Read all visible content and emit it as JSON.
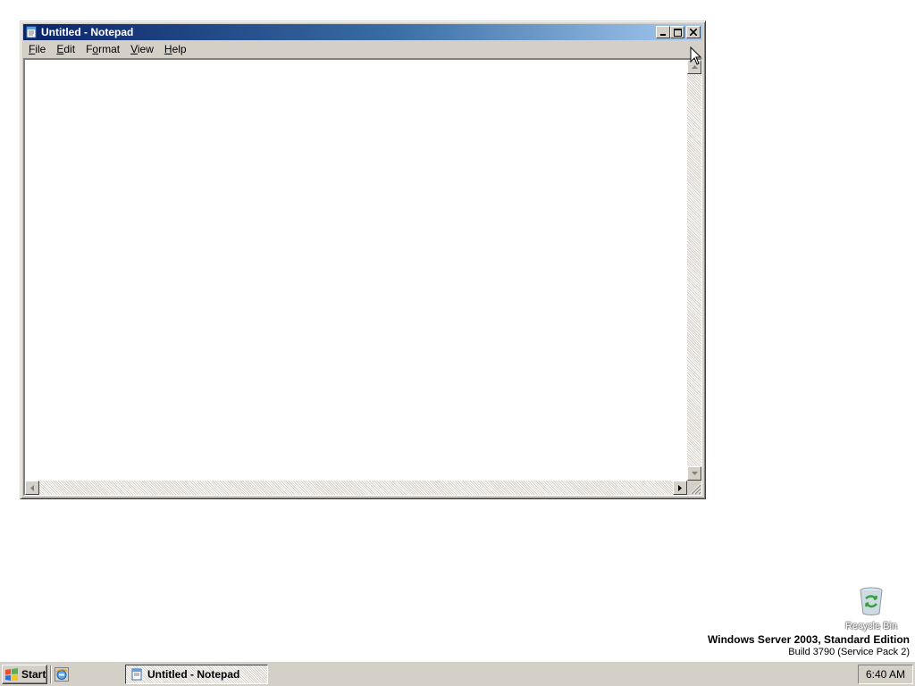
{
  "window": {
    "title": "Untitled - Notepad",
    "icon": "notepad-icon",
    "controls": [
      "minimize-icon",
      "maximize-icon",
      "close-icon"
    ]
  },
  "menu": {
    "items": [
      {
        "label": "File",
        "accel": "F",
        "rest": "ile"
      },
      {
        "label": "Edit",
        "accel": "E",
        "rest": "dit"
      },
      {
        "label": "Format",
        "accel": "o",
        "prefix": "F",
        "rest": "rmat"
      },
      {
        "label": "View",
        "accel": "V",
        "rest": "iew"
      },
      {
        "label": "Help",
        "accel": "H",
        "rest": "elp"
      }
    ]
  },
  "editor": {
    "content": ""
  },
  "desktop": {
    "recycle_bin_label": "Recycle Bin",
    "os_name": "Windows Server 2003, Standard Edition",
    "os_build": "Build 3790 (Service Pack 2)"
  },
  "taskbar": {
    "start_label": "Start",
    "task_label": "Untitled - Notepad",
    "clock": "6:40 AM"
  },
  "colors": {
    "titlebar_start": "#0a246a",
    "titlebar_end": "#a6caf0",
    "chrome": "#d4d0c8"
  }
}
